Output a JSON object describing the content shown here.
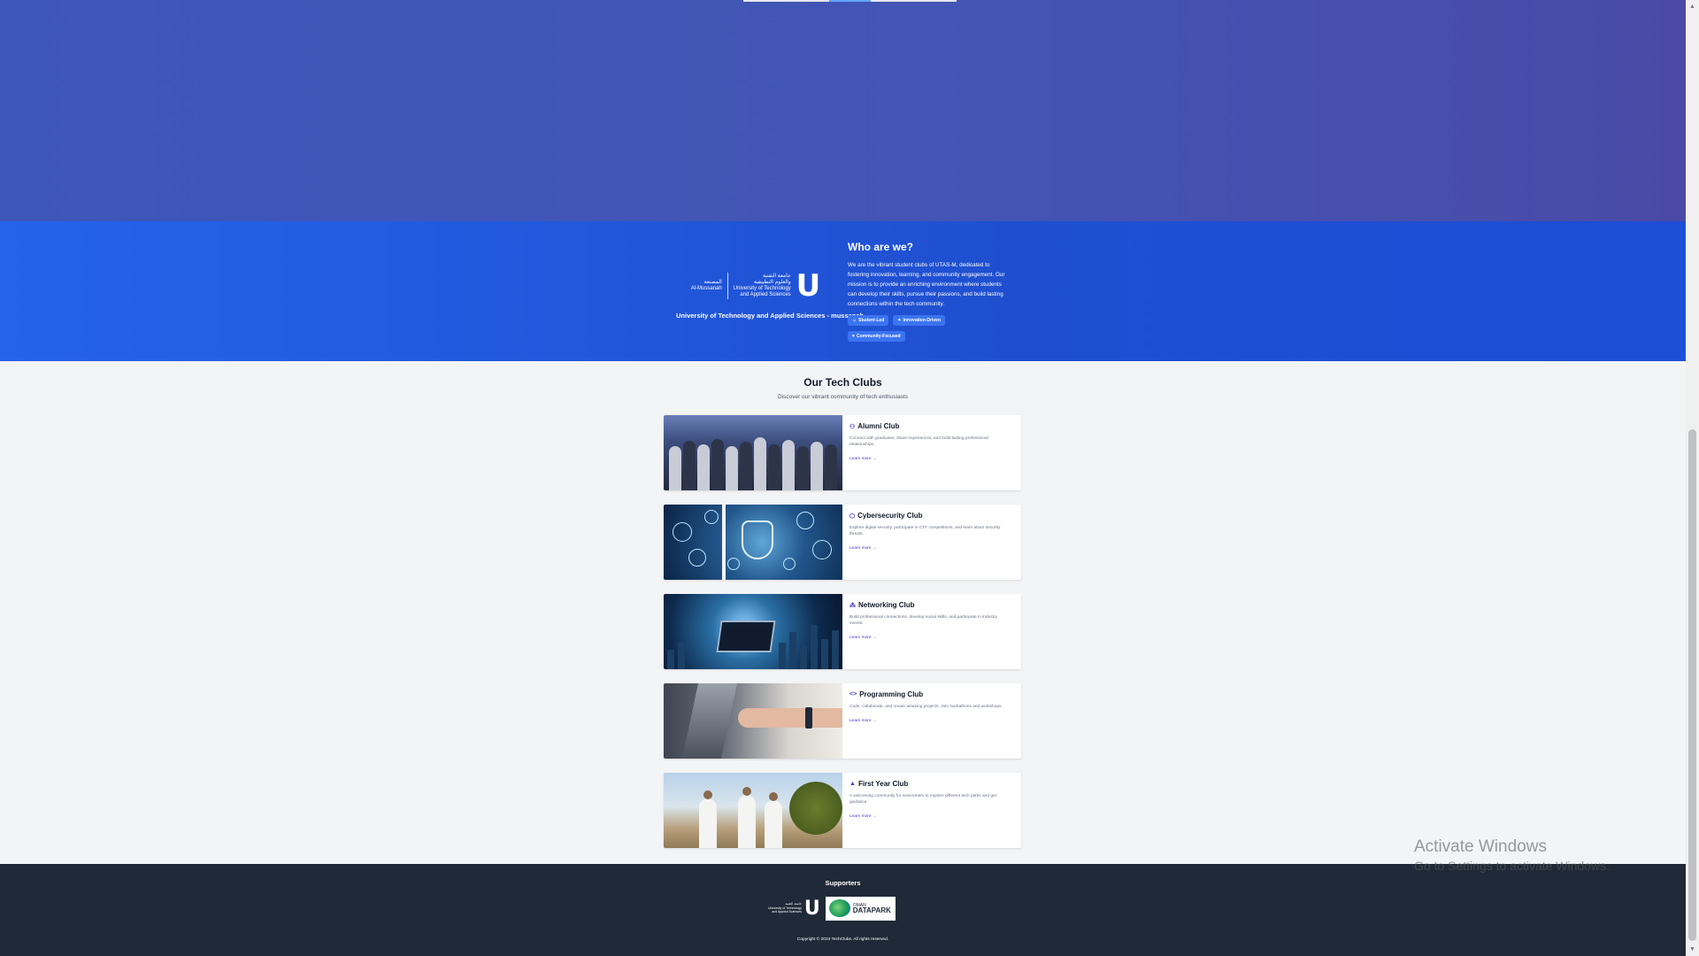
{
  "about": {
    "logo_arabic_1": "جامعة التقنية",
    "logo_arabic_2": "والعلوم التطبيقية",
    "logo_english_1": "University of Technology",
    "logo_english_2": "and Applied Sciences",
    "logo_left_arabic": "المصنعة",
    "logo_left_english": "Al-Mussanah",
    "logo_caption": "University of Technology and Applied Sciences - mussanah",
    "title": "Who are we?",
    "description": "We are the vibrant student clubs of UTAS-M, dedicated to fostering innovation, learning, and community engagement. Our mission is to provide an enriching environment where students can develop their skills, pursue their passions, and build lasting connections within the tech community.",
    "chips": [
      "Student-Led",
      "Innovation-Driven",
      "Community-Focused"
    ]
  },
  "clubs": {
    "title": "Our Tech Clubs",
    "subtitle": "Discover our vibrant community of tech enthusiasts",
    "items": [
      {
        "name": "Alumni Club",
        "icon": "users-icon",
        "description": "Connect with graduates, share experiences, and build lasting professional relationships.",
        "link": "Learn more →"
      },
      {
        "name": "Cybersecurity Club",
        "icon": "shield-icon",
        "description": "Explore digital security, participate in CTF competitions, and learn about security threats.",
        "link": "Learn more →"
      },
      {
        "name": "Networking Club",
        "icon": "network-icon",
        "description": "Build professional connections, develop social skills, and participate in industry events.",
        "link": "Learn more →"
      },
      {
        "name": "Programming Club",
        "icon": "code-icon",
        "description": "Code, collaborate, and create amazing projects. Join hackathons and workshops.",
        "link": "Learn more →"
      },
      {
        "name": "First Year Club",
        "icon": "graduation-cap-icon",
        "description": "A welcoming community for newcomers to explore different tech paths and get guidance.",
        "link": "Learn more →"
      }
    ]
  },
  "footer": {
    "supporters_title": "Supporters",
    "odp_line1": "OMAN",
    "odp_line2": "DATAPARK",
    "copyright": "Copyright © 2024 TechClubs. All rights reserved."
  },
  "watermark": {
    "title": "Activate Windows",
    "subtitle": "Go to Settings to activate Windows."
  },
  "colors": {
    "hero": "#4355b6",
    "about_band": "#2563eb",
    "accent": "#4338ca",
    "footer": "#1f2937"
  }
}
